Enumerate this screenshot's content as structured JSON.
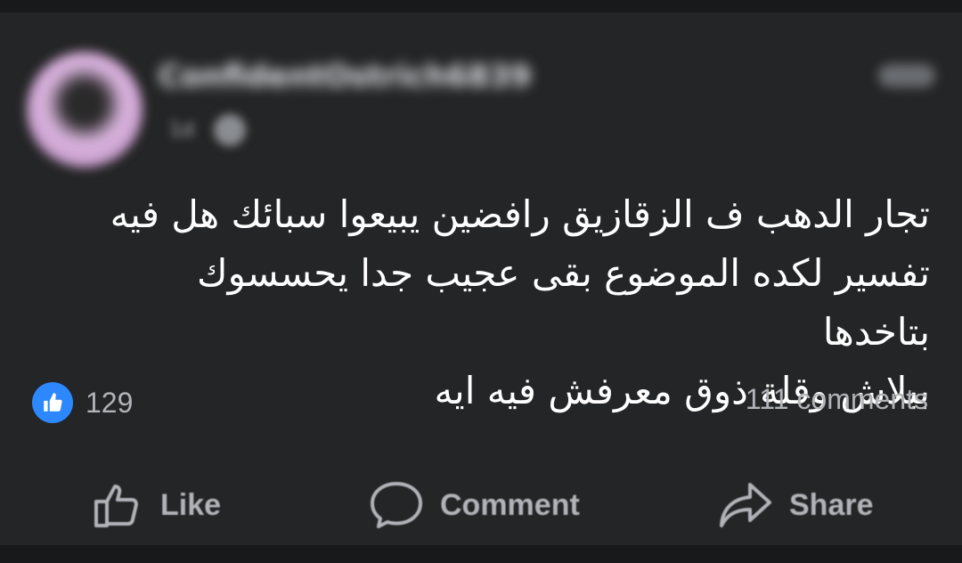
{
  "post": {
    "author": "ConfidentOstrich6839",
    "time": "1d",
    "body_lines": [
      "تجار الدهب ف الزقازيق رافضين يبيعوا سبائك هل فيه",
      "تفسير لكده الموضوع بقى عجيب جدا يحسسوك بتاخدها",
      "ببلاش وقلة ذوق معرفش فيه ايه"
    ],
    "reaction_count": "129",
    "comments_count": "111 comments"
  },
  "actions": {
    "like": "Like",
    "comment": "Comment",
    "share": "Share"
  },
  "colors": {
    "background": "#242526",
    "text": "#ffffff",
    "secondary_text": "#b0b3b8",
    "like_blue": "#2d88ff"
  },
  "icons": {
    "like_badge": "thumbs-up-icon",
    "like_action": "thumbs-up-outline-icon",
    "comment_action": "speech-bubble-icon",
    "share_action": "share-arrow-icon",
    "privacy": "globe-icon",
    "more": "more-options-icon"
  }
}
